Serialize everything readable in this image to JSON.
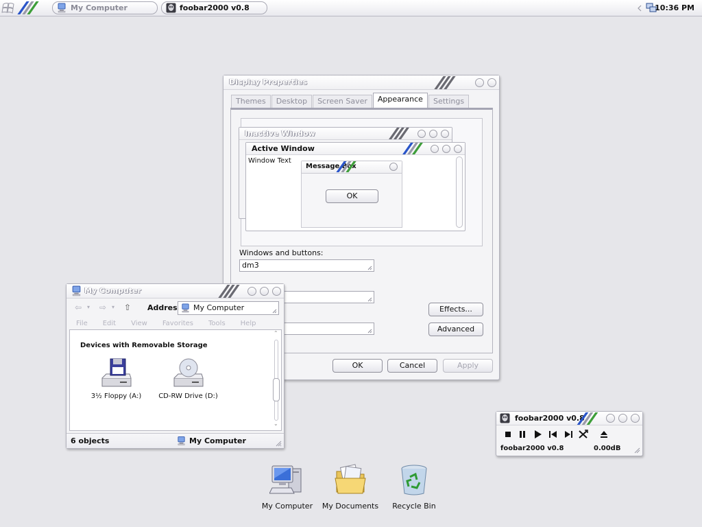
{
  "taskbar": {
    "tasks": [
      {
        "label": "My Computer",
        "state": "inactive"
      },
      {
        "label": "foobar2000 v0.8",
        "state": "active"
      }
    ],
    "clock": "10:36 PM"
  },
  "display_properties": {
    "title": "Display Properties",
    "tabs": [
      "Themes",
      "Desktop",
      "Screen Saver",
      "Appearance",
      "Settings"
    ],
    "selected_tab": "Appearance",
    "preview": {
      "inactive_title": "Inactive Window",
      "active_title": "Active Window",
      "window_text": "Window Text",
      "message_box_title": "Message Box",
      "ok_label": "OK"
    },
    "windows_buttons_label": "Windows and buttons:",
    "windows_buttons_value": "dm3",
    "effects_label": "Effects...",
    "advanced_label": "Advanced",
    "ok_label": "OK",
    "cancel_label": "Cancel",
    "apply_label": "Apply"
  },
  "my_computer": {
    "title": "My Computer",
    "address_label": "Address",
    "address_value": "My Computer",
    "menu": [
      "File",
      "Edit",
      "View",
      "Favorites",
      "Tools",
      "Help"
    ],
    "group_heading": "Devices with Removable Storage",
    "items": [
      {
        "label": "3½ Floppy (A:)",
        "icon": "floppy-drive-icon"
      },
      {
        "label": "CD-RW Drive (D:)",
        "icon": "cd-drive-icon"
      }
    ],
    "status_count": "6 objects",
    "status_location": "My Computer"
  },
  "foobar": {
    "title": "foobar2000 v0.8",
    "now_playing": "foobar2000 v0.8",
    "volume": "0.00dB"
  },
  "desktop_icons": [
    {
      "label": "My Computer",
      "icon": "my-computer-icon"
    },
    {
      "label": "My Documents",
      "icon": "my-documents-icon"
    },
    {
      "label": "Recycle Bin",
      "icon": "recycle-bin-icon"
    }
  ],
  "colors": {
    "desktop": "#e6e6ea",
    "stripe_blue": "#2a55c9",
    "stripe_green": "#3e9e3a",
    "stripe_grey": "#6a6a72"
  }
}
